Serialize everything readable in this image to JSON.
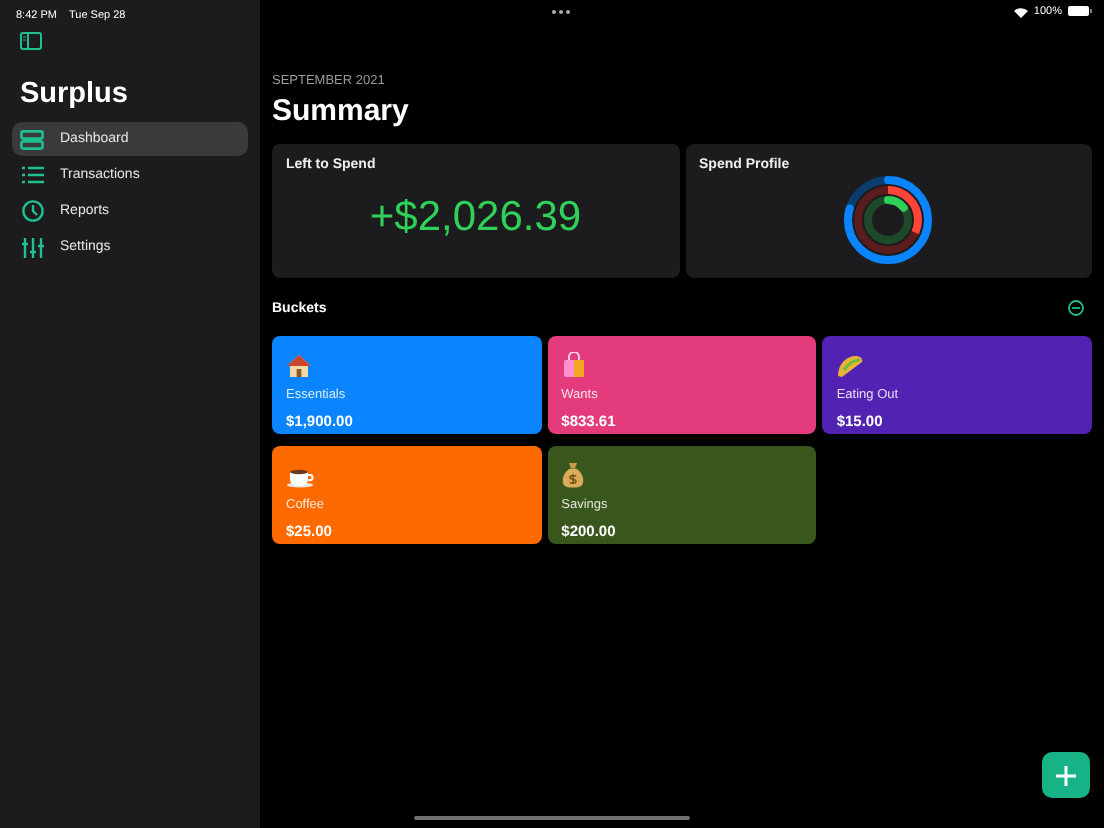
{
  "status_bar": {
    "time": "8:42 PM",
    "date": "Tue Sep 28",
    "battery": "100%"
  },
  "sidebar": {
    "title": "Surplus",
    "items": [
      {
        "label": "Dashboard",
        "selected": true
      },
      {
        "label": "Transactions",
        "selected": false
      },
      {
        "label": "Reports",
        "selected": false
      },
      {
        "label": "Settings",
        "selected": false
      }
    ]
  },
  "header": {
    "period": "SEPTEMBER 2021",
    "title": "Summary"
  },
  "left_to_spend": {
    "title": "Left to Spend",
    "amount": "+$2,026.39"
  },
  "spend_profile": {
    "title": "Spend Profile"
  },
  "buckets": {
    "title": "Buckets",
    "items": [
      {
        "name": "Essentials",
        "amount": "$1,900.00",
        "color": "#0a84ff"
      },
      {
        "name": "Wants",
        "amount": "$833.61",
        "color": "#e33b7c"
      },
      {
        "name": "Eating Out",
        "amount": "$15.00",
        "color": "#5223b3"
      },
      {
        "name": "Coffee",
        "amount": "$25.00",
        "color": "#ff6a00"
      },
      {
        "name": "Savings",
        "amount": "$200.00",
        "color": "#39561c"
      }
    ]
  }
}
